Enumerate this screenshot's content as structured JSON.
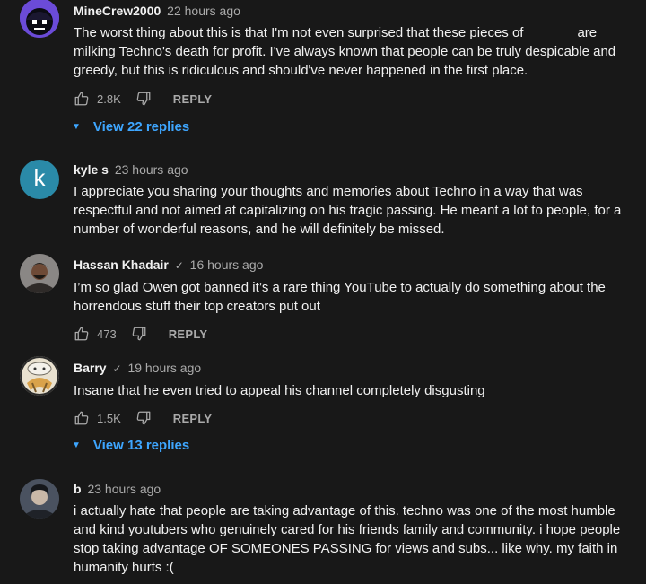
{
  "comments": [
    {
      "author": "MineCrew2000",
      "verified": false,
      "time": "22 hours ago",
      "text_before_redaction": "The worst thing about this is that I'm not even surprised that these pieces of",
      "text_after_redaction": "are milking Techno's death for profit. I've always known that people can be truly despicable and greedy, but this is ridiculous and should've never happened in the first place.",
      "likes": "2.8K",
      "reply_label": "REPLY",
      "view_replies": "View 22 replies"
    },
    {
      "author": "kyle s",
      "avatar_letter": "k",
      "avatar_color": "#2a8aa8",
      "verified": false,
      "time": "23 hours ago",
      "text": "I appreciate you sharing your thoughts and memories about Techno in a way that was respectful and not aimed at capitalizing on his tragic passing. He meant a lot to people, for a number of wonderful reasons, and he will definitely be missed."
    },
    {
      "author": "Hassan Khadair",
      "verified": true,
      "time": "16 hours ago",
      "text": "I’m so glad Owen got banned it’s a rare thing YouTube to actually do something about the horrendous stuff their top creators put out",
      "likes": "473",
      "reply_label": "REPLY"
    },
    {
      "author": "Barry",
      "verified": true,
      "time": "19 hours ago",
      "text": "Insane that he even tried to appeal his channel completely disgusting",
      "likes": "1.5K",
      "reply_label": "REPLY",
      "view_replies": "View 13 replies"
    },
    {
      "author": "b",
      "verified": false,
      "time": "23 hours ago",
      "text": "i actually hate that people are taking advantage of this. techno was one of the most humble and kind youtubers who genuinely cared for his friends family and community. i hope people stop taking advantage OF SOMEONES PASSING for views and subs... like why. my faith in humanity hurts :("
    }
  ],
  "colors": {
    "background": "#181818",
    "link_blue": "#3ea6ff",
    "secondary_text": "#aaaaaa"
  },
  "icons": {
    "like": "thumbs-up-icon",
    "dislike": "thumbs-down-icon",
    "verified": "check-icon",
    "expand": "triangle-down-icon"
  }
}
